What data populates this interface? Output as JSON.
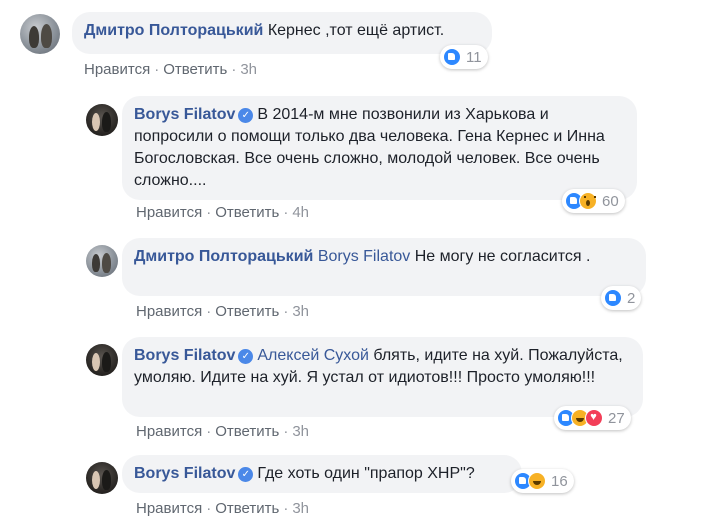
{
  "comments": [
    {
      "author": "Дмитро Полторацький",
      "text": "Кернес ,тот ещё артист.",
      "like": "Нравится",
      "reply": "Ответить",
      "time": "3h",
      "reaction_count": "11"
    },
    {
      "author": "Borys Filatov",
      "verified": "✓",
      "text": "В 2014-м мне позвонили из Харькова и попросили о помощи только два человека. Гена Кернес и Инна Богословская. Все очень сложно, молодой человек. Все очень сложно....",
      "like": "Нравится",
      "reply": "Ответить",
      "time": "4h",
      "reaction_count": "60"
    },
    {
      "author": "Дмитро Полторацький",
      "mention": "Borys Filatov",
      "text": "Не могу не согласится .",
      "like": "Нравится",
      "reply": "Ответить",
      "time": "3h",
      "reaction_count": "2"
    },
    {
      "author": "Borys Filatov",
      "verified": "✓",
      "mention": "Алексей Сухой",
      "text": "блять, идите на хуй. Пожалуйста, умоляю. Идите на хуй. Я устал от идиотов!!! Просто умоляю!!!",
      "like": "Нравится",
      "reply": "Ответить",
      "time": "3h",
      "reaction_count": "27"
    },
    {
      "author": "Borys Filatov",
      "verified": "✓",
      "text": "Где хоть один \"прапор ХНР\"?",
      "like": "Нравится",
      "reply": "Ответить",
      "time": "3h",
      "reaction_count": "16"
    }
  ],
  "separator": "·",
  "colors": {
    "link": "#385898",
    "bubble": "#f2f3f5",
    "like": "#2d88ff",
    "love": "#f33e58",
    "wow": "#f7b125"
  }
}
